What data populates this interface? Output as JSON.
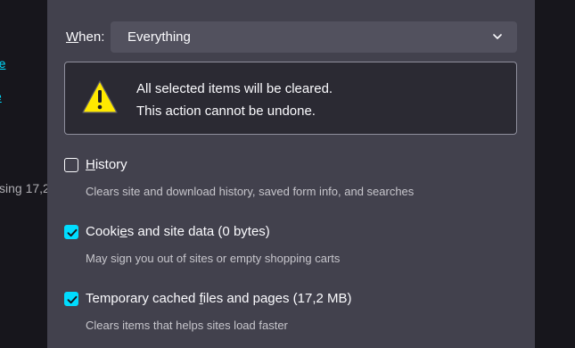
{
  "background": {
    "link_1": "re",
    "link_2": "e",
    "text": "sing 17,2"
  },
  "dialog": {
    "when_label": "When:",
    "when_value": "Everything",
    "warning": {
      "icon": "warning-triangle-icon",
      "line_1": "All selected items will be cleared.",
      "line_2": "This action cannot be undone."
    },
    "items": [
      {
        "label": "History",
        "description": "Clears site and download history, saved form info, and searches",
        "checked": false
      },
      {
        "label": "Cookies and site data (0 bytes)",
        "description": "May sign you out of sites or empty shopping carts",
        "checked": true
      },
      {
        "label": "Temporary cached files and pages (17,2 MB)",
        "description": "Clears items that helps sites load faster",
        "checked": true
      }
    ]
  },
  "colors": {
    "dialog_bg": "#42414d",
    "accent": "#00ddff",
    "select_bg": "#52515e",
    "warning_bg": "#2b2a33",
    "warning_yellow": "#ffe900"
  }
}
